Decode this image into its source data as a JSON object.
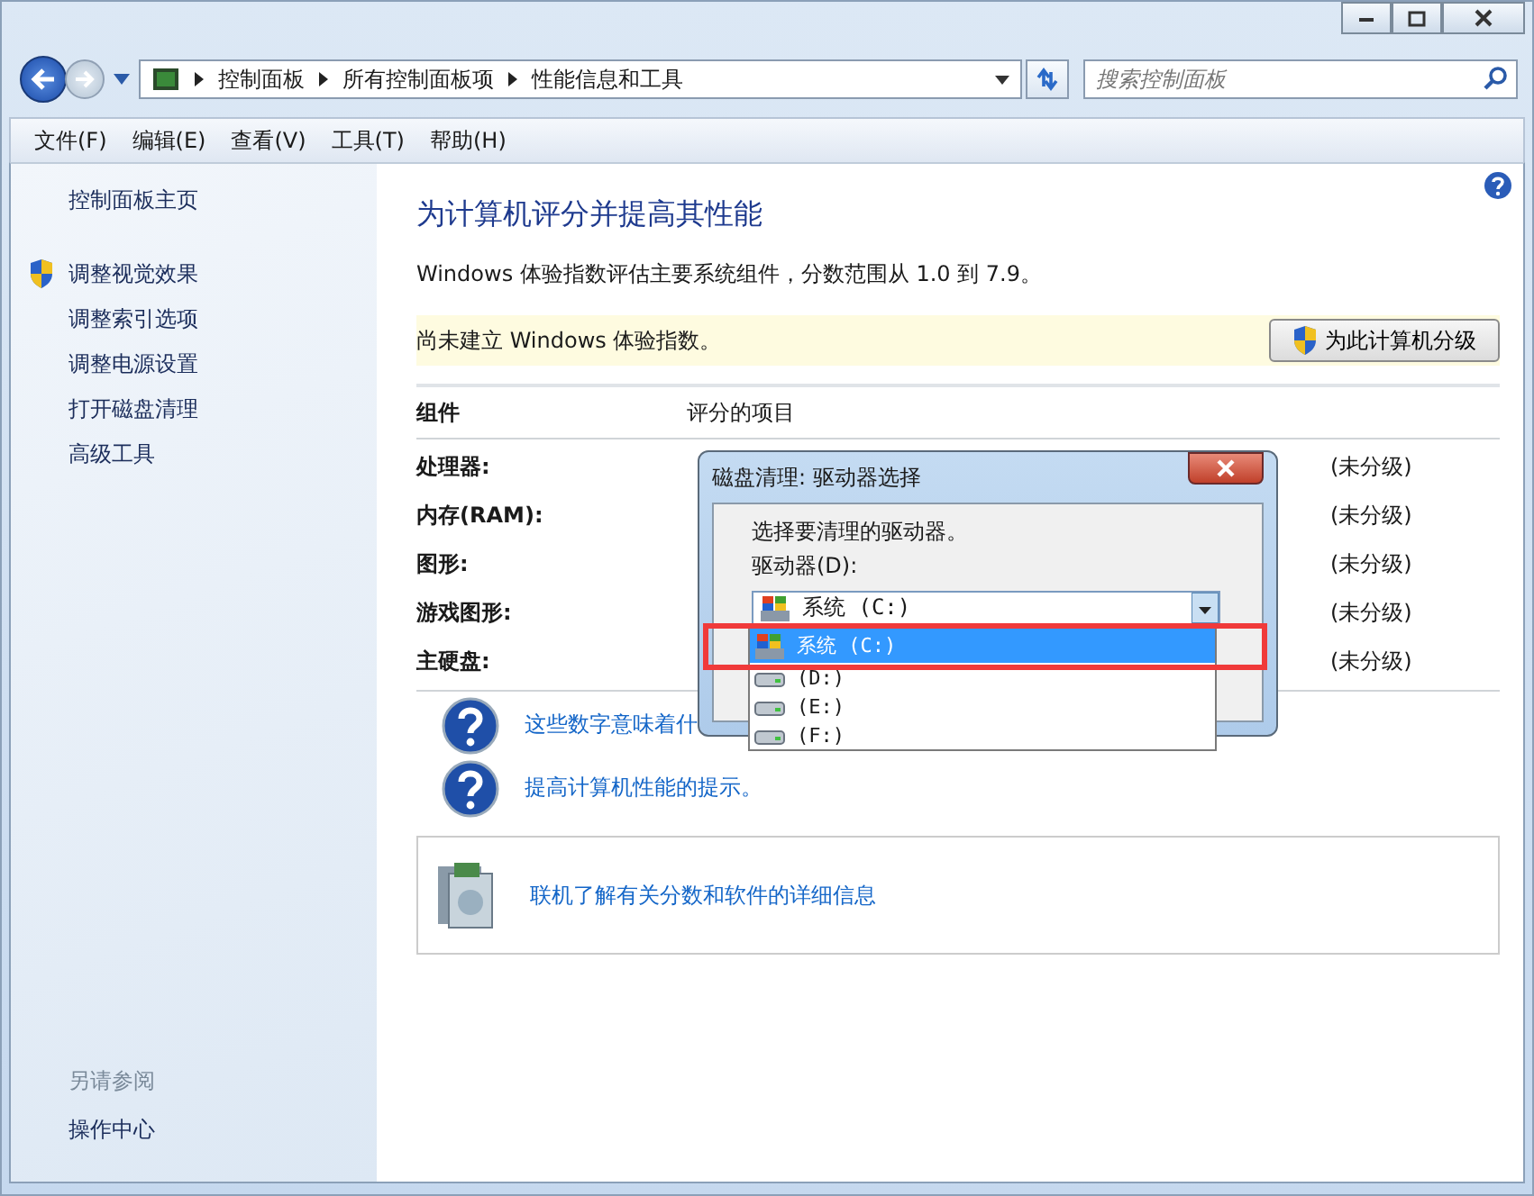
{
  "address": {
    "crumbs": [
      "控制面板",
      "所有控制面板项",
      "性能信息和工具"
    ]
  },
  "search": {
    "placeholder": "搜索控制面板"
  },
  "menu": [
    "文件(F)",
    "编辑(E)",
    "查看(V)",
    "工具(T)",
    "帮助(H)"
  ],
  "sidebar": {
    "home": "控制面板主页",
    "tasks": [
      {
        "label": "调整视觉效果",
        "kind": "shield"
      },
      {
        "label": "调整索引选项",
        "kind": "plain"
      },
      {
        "label": "调整电源设置",
        "kind": "plain"
      },
      {
        "label": "打开磁盘清理",
        "kind": "plain"
      },
      {
        "label": "高级工具",
        "kind": "plain"
      }
    ],
    "see_also": {
      "title": "另请参阅",
      "links": [
        "操作中心"
      ]
    }
  },
  "main": {
    "title": "为计算机评分并提高其性能",
    "description": "Windows 体验指数评估主要系统组件，分数范围从 1.0 到 7.9。",
    "notice": "尚未建立 Windows 体验指数。",
    "rate_button": "为此计算机分级",
    "table": {
      "columns": [
        "组件",
        "评分的项目"
      ],
      "rows": [
        {
          "component": "处理器:",
          "score": "(未分级)"
        },
        {
          "component": "内存(RAM):",
          "score": "(未分级)"
        },
        {
          "component": "图形:",
          "score": "(未分级)"
        },
        {
          "component": "游戏图形:",
          "score": "(未分级)"
        },
        {
          "component": "主硬盘:",
          "score": "(未分级)"
        }
      ]
    },
    "help_links": [
      "这些数字意味着什",
      "提高计算机性能的提示。"
    ],
    "online_link": "联机了解有关分数和软件的详细信息"
  },
  "dialog": {
    "title": "磁盘清理: 驱动器选择",
    "prompt": "选择要清理的驱动器。",
    "label": "驱动器(D):",
    "value": "系统 (C:)",
    "options": [
      {
        "label": "系统 (C:)",
        "kind": "system",
        "selected": true
      },
      {
        "label": "(D:)",
        "kind": "drive",
        "selected": false
      },
      {
        "label": "(E:)",
        "kind": "drive",
        "selected": false
      },
      {
        "label": "(F:)",
        "kind": "drive",
        "selected": false
      }
    ]
  }
}
